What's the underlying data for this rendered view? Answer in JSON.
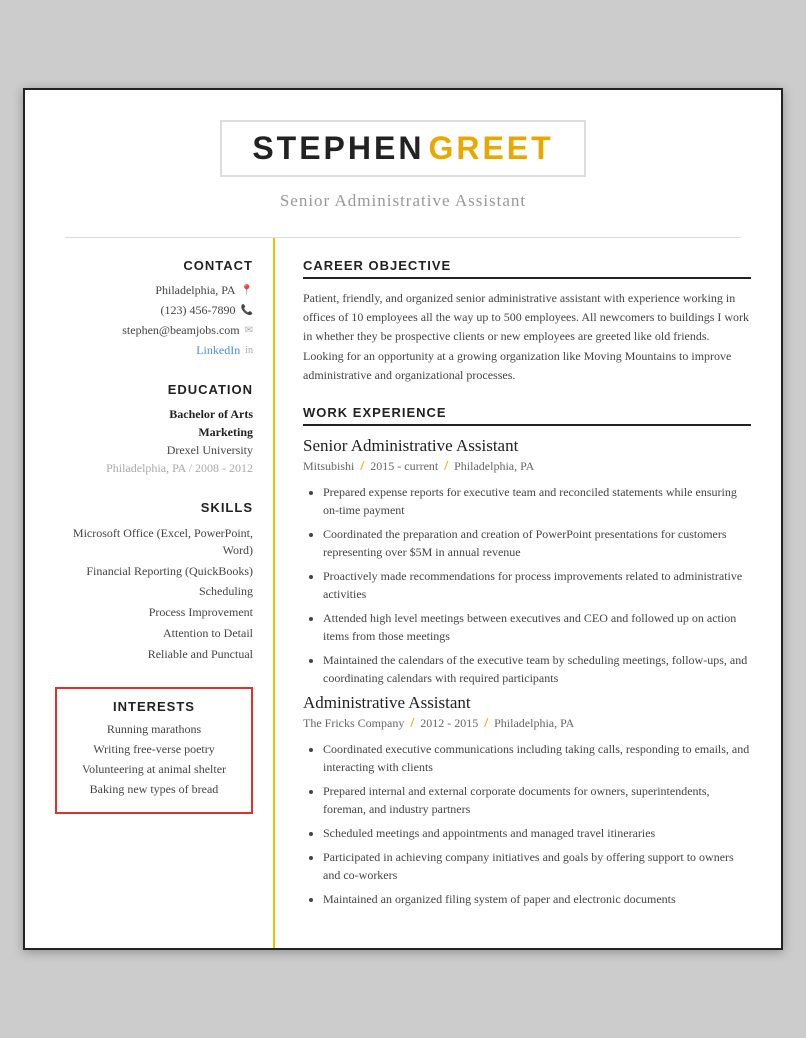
{
  "header": {
    "name_first": "STEPHEN",
    "name_last": "GREET",
    "subtitle": "Senior Administrative Assistant"
  },
  "sidebar": {
    "contact_title": "CONTACT",
    "contact": {
      "location": "Philadelphia, PA",
      "phone": "(123) 456-7890",
      "email": "stephen@beamjobs.com",
      "linkedin_label": "LinkedIn"
    },
    "education_title": "EDUCATION",
    "education": {
      "degree": "Bachelor of Arts",
      "major": "Marketing",
      "university": "Drexel University",
      "location_year": "Philadelphia, PA  /  2008 - 2012"
    },
    "skills_title": "SKILLS",
    "skills": [
      "Microsoft Office (Excel, PowerPoint, Word)",
      "Financial Reporting (QuickBooks)",
      "Scheduling",
      "Process Improvement",
      "Attention to Detail",
      "Reliable and Punctual"
    ],
    "interests_title": "INTERESTS",
    "interests": [
      "Running marathons",
      "Writing free-verse poetry",
      "Volunteering at animal shelter",
      "Baking new types of bread"
    ]
  },
  "main": {
    "career_objective_title": "CAREER OBJECTIVE",
    "career_objective": "Patient, friendly, and organized senior administrative assistant with experience working in offices of 10 employees all the way up to 500 employees. All newcomers to buildings I work in whether they be prospective clients or new employees are greeted like old friends. Looking for an opportunity at a growing organization like Moving Mountains to improve administrative and organizational processes.",
    "work_experience_title": "WORK EXPERIENCE",
    "jobs": [
      {
        "title": "Senior Administrative Assistant",
        "company": "Mitsubishi",
        "period": "2015 - current",
        "location": "Philadelphia, PA",
        "bullets": [
          "Prepared expense reports for executive team and reconciled statements while ensuring on-time payment",
          "Coordinated the preparation and creation of PowerPoint presentations for customers representing over $5M in annual revenue",
          "Proactively made recommendations for process improvements related to administrative activities",
          "Attended high level meetings between executives and CEO and followed up on action items from those meetings",
          "Maintained the calendars of the executive team by scheduling meetings, follow-ups, and coordinating calendars with required participants"
        ]
      },
      {
        "title": "Administrative Assistant",
        "company": "The Fricks Company",
        "period": "2012 - 2015",
        "location": "Philadelphia, PA",
        "bullets": [
          "Coordinated executive communications including taking calls, responding to emails, and interacting with clients",
          "Prepared internal and external corporate documents for owners, superintendents, foreman, and industry partners",
          "Scheduled meetings and appointments and managed travel itineraries",
          "Participated in achieving company initiatives and goals by offering support to owners and co-workers",
          "Maintained an organized filing system of paper and electronic documents"
        ]
      }
    ]
  }
}
